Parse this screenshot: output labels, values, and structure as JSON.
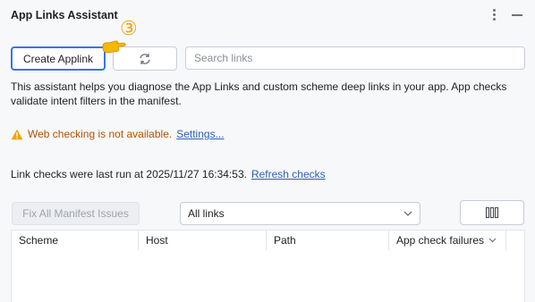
{
  "window": {
    "title": "App Links Assistant"
  },
  "toolbar": {
    "create_label": "Create Applink",
    "search_placeholder": "Search links"
  },
  "description": "This assistant helps you diagnose the App Links and custom scheme deep links in your app. App checks validate intent filters in the manifest.",
  "warning": {
    "text": "Web checking is not available.",
    "settings_link": "Settings..."
  },
  "last_run": {
    "text": "Link checks were last run at 2025/11/27 16:34:53.",
    "refresh_link": "Refresh checks"
  },
  "actions": {
    "fix_label": "Fix All Manifest Issues",
    "filter_value": "All links"
  },
  "table": {
    "columns": [
      "Scheme",
      "Host",
      "Path",
      "App check failures"
    ]
  },
  "annotation": {
    "step": "③"
  },
  "colors": {
    "accent": "#3574f0",
    "warning": "#b25200",
    "link": "#2f5fb3",
    "annotation": "#f0a400"
  }
}
